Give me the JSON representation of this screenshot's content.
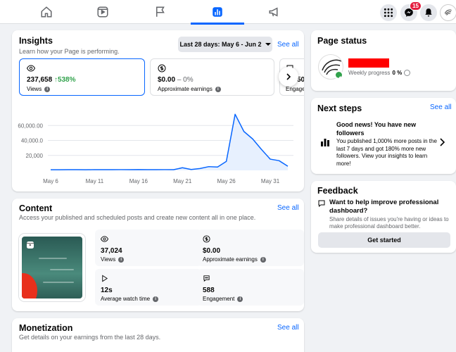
{
  "topbar": {
    "tabs": [
      {
        "name": "home",
        "icon": "home-icon"
      },
      {
        "name": "reels",
        "icon": "video-icon"
      },
      {
        "name": "pages",
        "icon": "flag-icon"
      },
      {
        "name": "insights",
        "icon": "bar-chart-icon",
        "active": true
      },
      {
        "name": "ads",
        "icon": "megaphone-icon"
      }
    ],
    "messenger_badge": "15",
    "accent": "#0866ff"
  },
  "insights": {
    "title": "Insights",
    "subtitle": "Learn how your Page is performing.",
    "date_range": "Last 28 days: May 6 - Jun 2",
    "see_all": "See all",
    "metrics": [
      {
        "value": "237,658",
        "change": "538%",
        "label": "Views"
      },
      {
        "value": "$0.00",
        "change": "0%",
        "label": "Approximate earnings"
      },
      {
        "value": "50",
        "label": "Engage"
      }
    ]
  },
  "chart_data": {
    "type": "area",
    "x": [
      "May 6",
      "May 7",
      "May 8",
      "May 9",
      "May 10",
      "May 11",
      "May 12",
      "May 13",
      "May 14",
      "May 15",
      "May 16",
      "May 17",
      "May 18",
      "May 19",
      "May 20",
      "May 21",
      "May 22",
      "May 23",
      "May 24",
      "May 25",
      "May 26",
      "May 27",
      "May 28",
      "May 29",
      "May 30",
      "May 31",
      "Jun 1",
      "Jun 2"
    ],
    "values": [
      800,
      800,
      900,
      900,
      800,
      1000,
      900,
      900,
      1000,
      900,
      1100,
      900,
      900,
      1000,
      900,
      3500,
      1200,
      2500,
      5000,
      4500,
      12000,
      75000,
      52000,
      42000,
      28000,
      15000,
      13000,
      5500
    ],
    "x_ticks": [
      "May 6",
      "May 11",
      "May 16",
      "May 21",
      "May 26",
      "May 31"
    ],
    "y_ticks": [
      "20,000",
      "40,000.0",
      "60,000.00"
    ],
    "ylim": [
      0,
      80000
    ],
    "color": "#0866ff",
    "fill": "#e7f0fe"
  },
  "content": {
    "title": "Content",
    "subtitle": "Access your published and scheduled posts and create new content all in one place.",
    "see_all": "See all",
    "stats": [
      {
        "value": "37,024",
        "label": "Views"
      },
      {
        "value": "$0.00",
        "label": "Approximate earnings"
      },
      {
        "value": "12s",
        "label": "Average watch time"
      },
      {
        "value": "588",
        "label": "Engagement"
      }
    ]
  },
  "monetization": {
    "title": "Monetization",
    "subtitle": "Get details on your earnings from the last 28 days.",
    "see_all": "See all"
  },
  "page_status": {
    "title": "Page status",
    "weekly_progress_label": "Weekly progress",
    "weekly_progress_value": "0 %"
  },
  "next_steps": {
    "title": "Next steps",
    "see_all": "See all",
    "headline": "Good news! You have new followers",
    "body": "You published 1,000% more posts in the last 7 days and got 180% more new followers. View your insights to learn more!"
  },
  "feedback": {
    "title": "Feedback",
    "headline": "Want to help improve professional dashboard?",
    "body": "Share details of issues you're having or ideas to make professional dashboard better.",
    "button": "Get started"
  }
}
